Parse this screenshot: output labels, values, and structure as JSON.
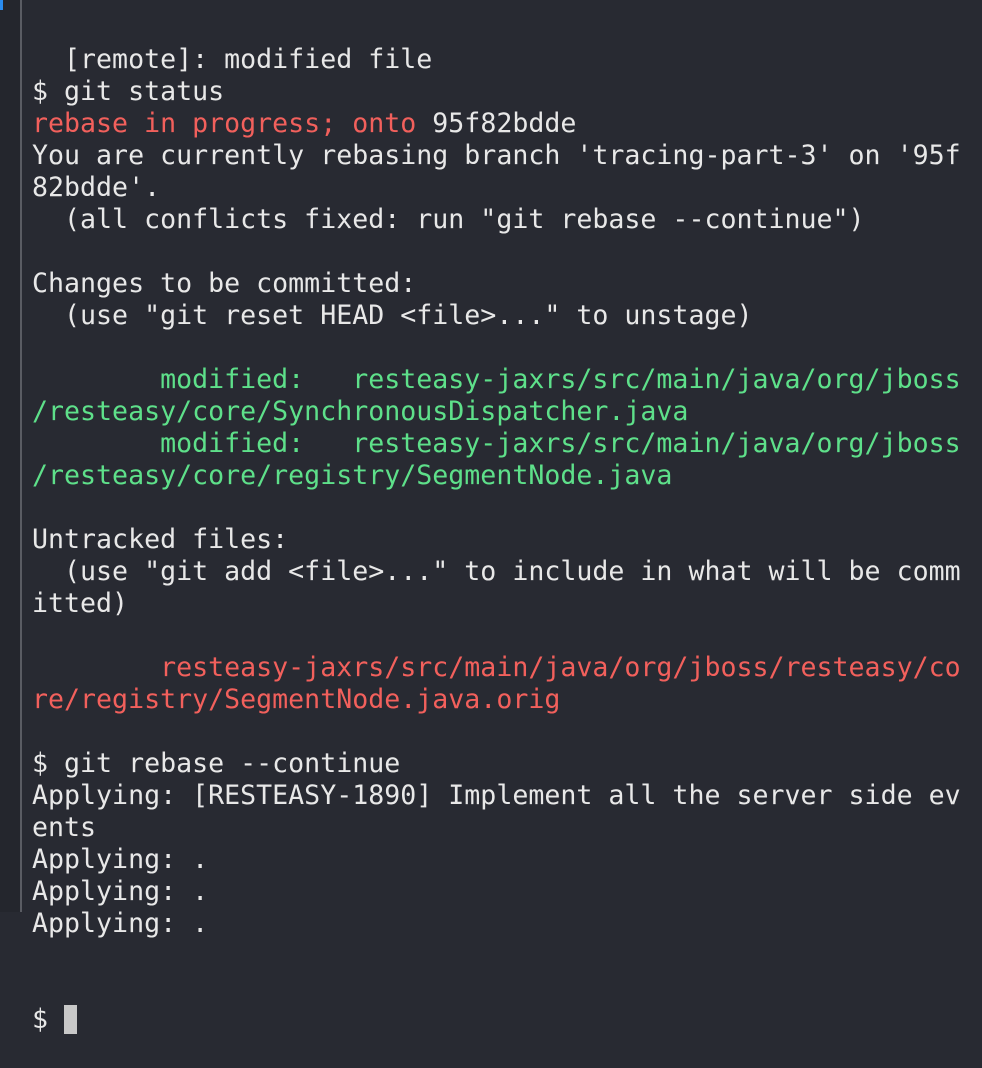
{
  "colors": {
    "background": "#282a32",
    "text": "#e8e8e8",
    "red": "#f2605c",
    "green": "#5ee08a"
  },
  "lines": [
    [
      {
        "t": "  [remote]: modified file",
        "c": "white"
      }
    ],
    [
      {
        "t": "$ git status",
        "c": "white"
      }
    ],
    [
      {
        "t": "rebase in progress; onto ",
        "c": "red"
      },
      {
        "t": "95f82bdde",
        "c": "white"
      }
    ],
    [
      {
        "t": "You are currently rebasing branch 'tracing-part-3' on '95f",
        "c": "white"
      }
    ],
    [
      {
        "t": "82bdde'.",
        "c": "white"
      }
    ],
    [
      {
        "t": "  (all conflicts fixed: run \"git rebase --continue\")",
        "c": "white"
      }
    ],
    [],
    [
      {
        "t": "Changes to be committed:",
        "c": "white"
      }
    ],
    [
      {
        "t": "  (use \"git reset HEAD <file>...\" to unstage)",
        "c": "white"
      }
    ],
    [],
    [
      {
        "t": "        modified:   resteasy-jaxrs/src/main/java/org/jboss",
        "c": "green"
      }
    ],
    [
      {
        "t": "/resteasy/core/SynchronousDispatcher.java",
        "c": "green"
      }
    ],
    [
      {
        "t": "        modified:   resteasy-jaxrs/src/main/java/org/jboss",
        "c": "green"
      }
    ],
    [
      {
        "t": "/resteasy/core/registry/SegmentNode.java",
        "c": "green"
      }
    ],
    [],
    [
      {
        "t": "Untracked files:",
        "c": "white"
      }
    ],
    [
      {
        "t": "  (use \"git add <file>...\" to include in what will be comm",
        "c": "white"
      }
    ],
    [
      {
        "t": "itted)",
        "c": "white"
      }
    ],
    [],
    [
      {
        "t": "        resteasy-jaxrs/src/main/java/org/jboss/resteasy/co",
        "c": "red"
      }
    ],
    [
      {
        "t": "re/registry/SegmentNode.java.orig",
        "c": "red"
      }
    ],
    [],
    [
      {
        "t": "$ git rebase --continue",
        "c": "white"
      }
    ],
    [
      {
        "t": "Applying: [RESTEASY-1890] Implement all the server side ev",
        "c": "white"
      }
    ],
    [
      {
        "t": "ents",
        "c": "white"
      }
    ],
    [
      {
        "t": "Applying: .",
        "c": "white"
      }
    ],
    [
      {
        "t": "Applying: .",
        "c": "white"
      }
    ],
    [
      {
        "t": "Applying: .",
        "c": "white"
      }
    ]
  ],
  "prompt": "$ "
}
